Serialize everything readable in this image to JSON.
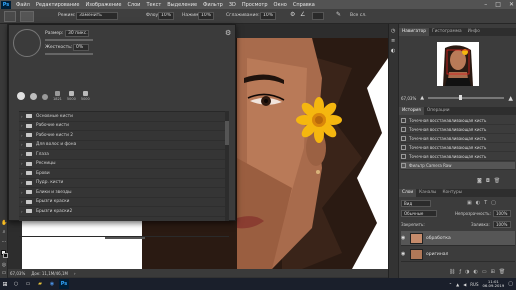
{
  "app": {
    "logo_text": "Ps"
  },
  "menu": [
    "Файл",
    "Редактирование",
    "Изображение",
    "Слои",
    "Текст",
    "Выделение",
    "Фильтр",
    "3D",
    "Просмотр",
    "Окно",
    "Справка"
  ],
  "options_bar": {
    "mode_label": "Режим:",
    "mode_value": "Заменить",
    "blend_label": "Флоу:",
    "blend_value": "10%",
    "opacity_label": "Нажим:",
    "opacity_value": "10%",
    "smooth_label": "Сглаживание:",
    "smooth_value": "10%",
    "sample_label": "Все сл."
  },
  "brush_dialog": {
    "size_label": "Размер:",
    "size_value": "30 пикс.",
    "hardness_label": "Жесткость:",
    "hardness_value": "0%",
    "presets": [
      "",
      "",
      "",
      "1821",
      "5000",
      "5000"
    ],
    "folders": [
      "Основные кисти",
      "Рабочие кисти",
      "Рабочие кисти 2",
      "Для волос и фона",
      "Глаза",
      "Ресницы",
      "Брови",
      "Пудр. кисти",
      "Блики и звезды",
      "Брызги краски",
      "Брызги краски2"
    ]
  },
  "status": {
    "zoom": "67,03%",
    "doc": "Док: 11,1М/46,1М"
  },
  "navigator": {
    "tabs": [
      "Навигатор",
      "Гистограмма",
      "Инфо"
    ],
    "zoom": "67,03%"
  },
  "history": {
    "tabs": [
      "История",
      "Операции"
    ],
    "items": [
      "Точечная восстанавливающая кисть",
      "Точечная восстанавливающая кисть",
      "Точечная восстанавливающая кисть",
      "Точечная восстанавливающая кисть",
      "Точечная восстанавливающая кисть",
      "Фильтр Camera Raw"
    ]
  },
  "layers": {
    "tabs": [
      "Слои",
      "Каналы",
      "Контуры"
    ],
    "kind_label": "Вид",
    "blend_mode": "Обычные",
    "opacity_label": "Непрозрачность:",
    "opacity_value": "100%",
    "lock_label": "Закрепить:",
    "fill_label": "Заливка:",
    "fill_value": "100%",
    "items": [
      "обработка",
      "оригинал"
    ]
  },
  "taskbar": {
    "lang": "RUS",
    "time": "11:01",
    "date": "06.09.2019"
  },
  "colors": {
    "accent": "#31a8ff",
    "panel": "#3c3c3c",
    "flower": "#f5b70f"
  }
}
